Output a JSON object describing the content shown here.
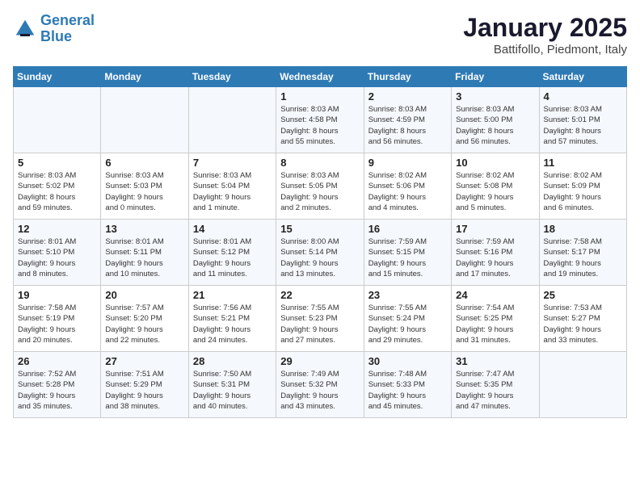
{
  "logo": {
    "line1": "General",
    "line2": "Blue"
  },
  "header": {
    "title": "January 2025",
    "subtitle": "Battifollo, Piedmont, Italy"
  },
  "weekdays": [
    "Sunday",
    "Monday",
    "Tuesday",
    "Wednesday",
    "Thursday",
    "Friday",
    "Saturday"
  ],
  "weeks": [
    [
      {
        "day": "",
        "info": ""
      },
      {
        "day": "",
        "info": ""
      },
      {
        "day": "",
        "info": ""
      },
      {
        "day": "1",
        "info": "Sunrise: 8:03 AM\nSunset: 4:58 PM\nDaylight: 8 hours\nand 55 minutes."
      },
      {
        "day": "2",
        "info": "Sunrise: 8:03 AM\nSunset: 4:59 PM\nDaylight: 8 hours\nand 56 minutes."
      },
      {
        "day": "3",
        "info": "Sunrise: 8:03 AM\nSunset: 5:00 PM\nDaylight: 8 hours\nand 56 minutes."
      },
      {
        "day": "4",
        "info": "Sunrise: 8:03 AM\nSunset: 5:01 PM\nDaylight: 8 hours\nand 57 minutes."
      }
    ],
    [
      {
        "day": "5",
        "info": "Sunrise: 8:03 AM\nSunset: 5:02 PM\nDaylight: 8 hours\nand 59 minutes."
      },
      {
        "day": "6",
        "info": "Sunrise: 8:03 AM\nSunset: 5:03 PM\nDaylight: 9 hours\nand 0 minutes."
      },
      {
        "day": "7",
        "info": "Sunrise: 8:03 AM\nSunset: 5:04 PM\nDaylight: 9 hours\nand 1 minute."
      },
      {
        "day": "8",
        "info": "Sunrise: 8:03 AM\nSunset: 5:05 PM\nDaylight: 9 hours\nand 2 minutes."
      },
      {
        "day": "9",
        "info": "Sunrise: 8:02 AM\nSunset: 5:06 PM\nDaylight: 9 hours\nand 4 minutes."
      },
      {
        "day": "10",
        "info": "Sunrise: 8:02 AM\nSunset: 5:08 PM\nDaylight: 9 hours\nand 5 minutes."
      },
      {
        "day": "11",
        "info": "Sunrise: 8:02 AM\nSunset: 5:09 PM\nDaylight: 9 hours\nand 6 minutes."
      }
    ],
    [
      {
        "day": "12",
        "info": "Sunrise: 8:01 AM\nSunset: 5:10 PM\nDaylight: 9 hours\nand 8 minutes."
      },
      {
        "day": "13",
        "info": "Sunrise: 8:01 AM\nSunset: 5:11 PM\nDaylight: 9 hours\nand 10 minutes."
      },
      {
        "day": "14",
        "info": "Sunrise: 8:01 AM\nSunset: 5:12 PM\nDaylight: 9 hours\nand 11 minutes."
      },
      {
        "day": "15",
        "info": "Sunrise: 8:00 AM\nSunset: 5:14 PM\nDaylight: 9 hours\nand 13 minutes."
      },
      {
        "day": "16",
        "info": "Sunrise: 7:59 AM\nSunset: 5:15 PM\nDaylight: 9 hours\nand 15 minutes."
      },
      {
        "day": "17",
        "info": "Sunrise: 7:59 AM\nSunset: 5:16 PM\nDaylight: 9 hours\nand 17 minutes."
      },
      {
        "day": "18",
        "info": "Sunrise: 7:58 AM\nSunset: 5:17 PM\nDaylight: 9 hours\nand 19 minutes."
      }
    ],
    [
      {
        "day": "19",
        "info": "Sunrise: 7:58 AM\nSunset: 5:19 PM\nDaylight: 9 hours\nand 20 minutes."
      },
      {
        "day": "20",
        "info": "Sunrise: 7:57 AM\nSunset: 5:20 PM\nDaylight: 9 hours\nand 22 minutes."
      },
      {
        "day": "21",
        "info": "Sunrise: 7:56 AM\nSunset: 5:21 PM\nDaylight: 9 hours\nand 24 minutes."
      },
      {
        "day": "22",
        "info": "Sunrise: 7:55 AM\nSunset: 5:23 PM\nDaylight: 9 hours\nand 27 minutes."
      },
      {
        "day": "23",
        "info": "Sunrise: 7:55 AM\nSunset: 5:24 PM\nDaylight: 9 hours\nand 29 minutes."
      },
      {
        "day": "24",
        "info": "Sunrise: 7:54 AM\nSunset: 5:25 PM\nDaylight: 9 hours\nand 31 minutes."
      },
      {
        "day": "25",
        "info": "Sunrise: 7:53 AM\nSunset: 5:27 PM\nDaylight: 9 hours\nand 33 minutes."
      }
    ],
    [
      {
        "day": "26",
        "info": "Sunrise: 7:52 AM\nSunset: 5:28 PM\nDaylight: 9 hours\nand 35 minutes."
      },
      {
        "day": "27",
        "info": "Sunrise: 7:51 AM\nSunset: 5:29 PM\nDaylight: 9 hours\nand 38 minutes."
      },
      {
        "day": "28",
        "info": "Sunrise: 7:50 AM\nSunset: 5:31 PM\nDaylight: 9 hours\nand 40 minutes."
      },
      {
        "day": "29",
        "info": "Sunrise: 7:49 AM\nSunset: 5:32 PM\nDaylight: 9 hours\nand 43 minutes."
      },
      {
        "day": "30",
        "info": "Sunrise: 7:48 AM\nSunset: 5:33 PM\nDaylight: 9 hours\nand 45 minutes."
      },
      {
        "day": "31",
        "info": "Sunrise: 7:47 AM\nSunset: 5:35 PM\nDaylight: 9 hours\nand 47 minutes."
      },
      {
        "day": "",
        "info": ""
      }
    ]
  ]
}
